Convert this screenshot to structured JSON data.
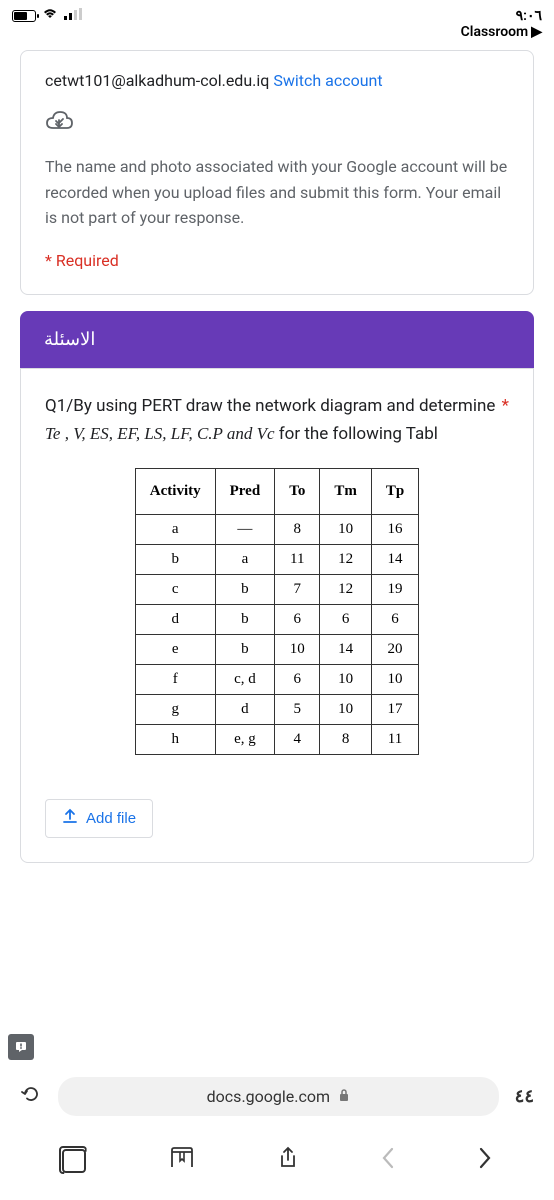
{
  "status": {
    "time": "٩:٠٦",
    "classroom": "Classroom"
  },
  "account": {
    "email": "cetwt101@alkadhum-col.edu.iq",
    "switch_label": "Switch account",
    "info": "The name and photo associated with your Google account will be recorded when you upload files and submit this form. Your email is not part of your response.",
    "required_label": "* Required"
  },
  "section": {
    "title": "الاسئلة"
  },
  "question": {
    "prefix": "Q1/By using PERT draw the network diagram and determine ",
    "vars": "Te , V, ES, EF, LS, LF, C.P and Vc",
    "suffix": " for the following Tabl",
    "required": "*"
  },
  "table": {
    "headers": [
      "Activity",
      "Pred",
      "To",
      "Tm",
      "Tp"
    ],
    "rows": [
      [
        "a",
        "—",
        "8",
        "10",
        "16"
      ],
      [
        "b",
        "a",
        "11",
        "12",
        "14"
      ],
      [
        "c",
        "b",
        "7",
        "12",
        "19"
      ],
      [
        "d",
        "b",
        "6",
        "6",
        "6"
      ],
      [
        "e",
        "b",
        "10",
        "14",
        "20"
      ],
      [
        "f",
        "c, d",
        "6",
        "10",
        "10"
      ],
      [
        "g",
        "d",
        "5",
        "10",
        "17"
      ],
      [
        "h",
        "e, g",
        "4",
        "8",
        "11"
      ]
    ]
  },
  "actions": {
    "add_file": "Add file"
  },
  "browser": {
    "url": "docs.google.com",
    "tab_count": "٤٤"
  }
}
